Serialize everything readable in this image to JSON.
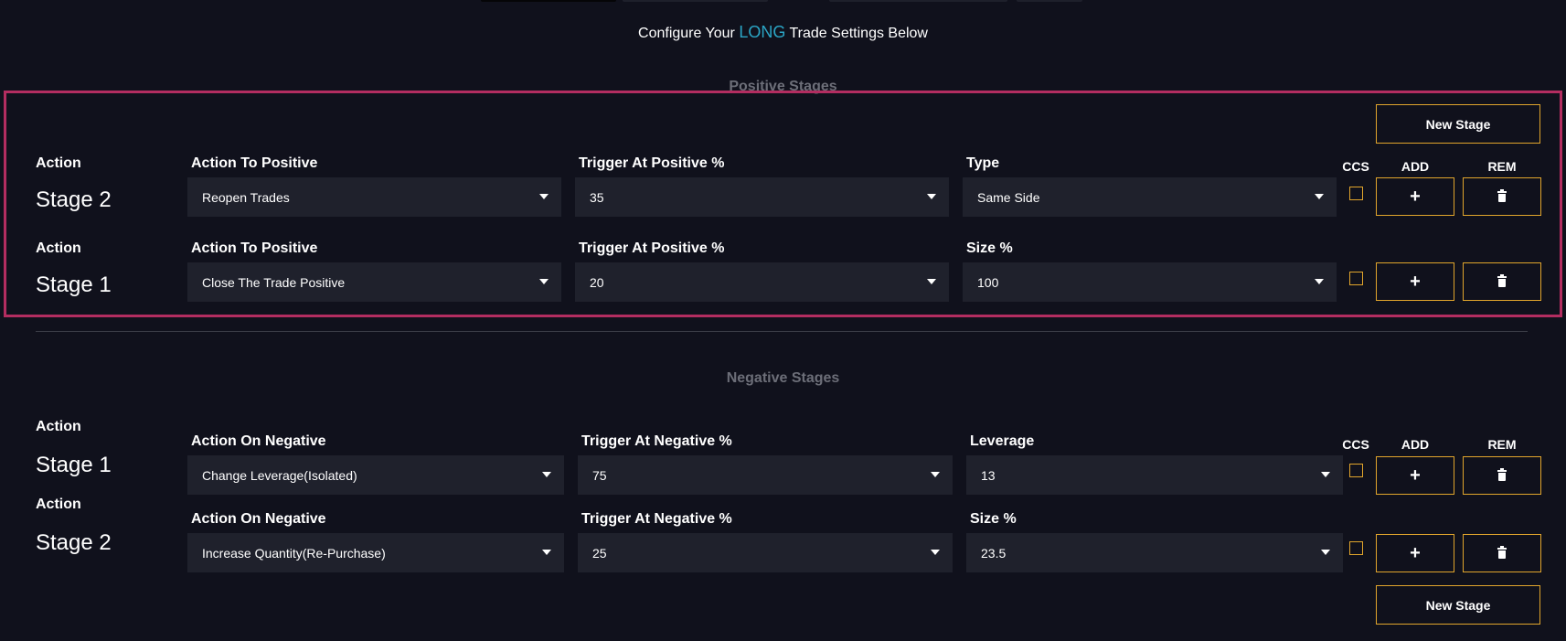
{
  "header": {
    "prefix": "Configure Your",
    "accent": "LONG",
    "suffix": "Trade Settings Below"
  },
  "positive": {
    "title": "Positive Stages",
    "new_stage_label": "New Stage",
    "col_ccs": "CCS",
    "col_add": "ADD",
    "col_rem": "REM",
    "rows": [
      {
        "action_label": "Action",
        "stage": "Stage 2",
        "field1_label": "Action To Positive",
        "field1_value": "Reopen Trades",
        "field2_label": "Trigger At Positive %",
        "field2_value": "35",
        "field3_label": "Type",
        "field3_value": "Same Side"
      },
      {
        "action_label": "Action",
        "stage": "Stage 1",
        "field1_label": "Action To Positive",
        "field1_value": "Close The Trade Positive",
        "field2_label": "Trigger At Positive %",
        "field2_value": "20",
        "field3_label": "Size %",
        "field3_value": "100"
      }
    ]
  },
  "negative": {
    "title": "Negative Stages",
    "new_stage_label": "New Stage",
    "col_ccs": "CCS",
    "col_add": "ADD",
    "col_rem": "REM",
    "rows": [
      {
        "action_label": "Action",
        "stage": "Stage 1",
        "field1_label": "Action On Negative",
        "field1_value": "Change Leverage(Isolated)",
        "field2_label": "Trigger At Negative %",
        "field2_value": "75",
        "field3_label": "Leverage",
        "field3_value": "13"
      },
      {
        "action_label": "Action",
        "stage": "Stage 2",
        "field1_label": "Action On Negative",
        "field1_value": "Increase Quantity(Re-Purchase)",
        "field2_label": "Trigger At Negative %",
        "field2_value": "25",
        "field3_label": "Size %",
        "field3_value": "23.5"
      }
    ]
  },
  "icons": {
    "add": "plus-icon",
    "remove": "trash-icon",
    "dropdown": "caret-down-icon"
  },
  "colors": {
    "background": "#10111c",
    "field": "#1f212c",
    "accent_blue": "#2ba6c6",
    "button_border": "#e1a52c",
    "highlight_border": "#b32d60",
    "section_title": "#6c6e78"
  }
}
